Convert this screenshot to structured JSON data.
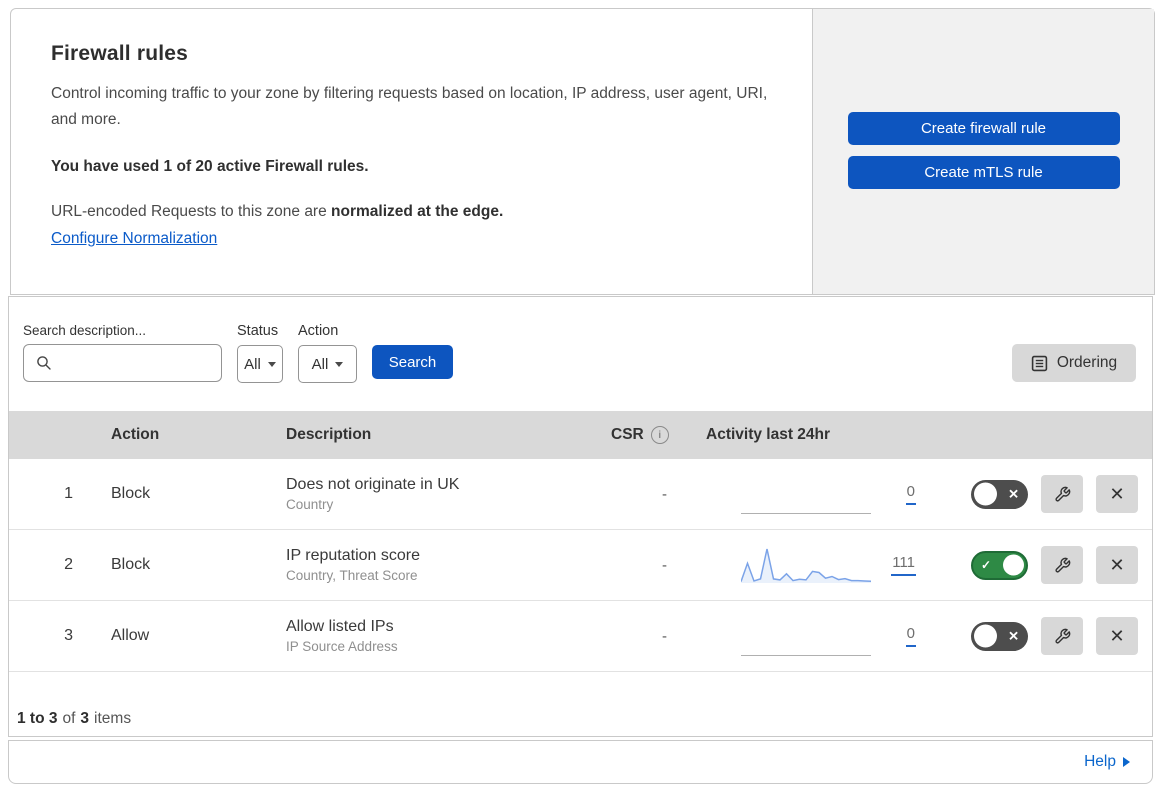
{
  "hero": {
    "title": "Firewall rules",
    "description": "Control incoming traffic to your zone by filtering requests based on location, IP address, user agent, URI, and more.",
    "usage_bold": "You have used 1 of 20 active Firewall rules.",
    "normalization_text": "URL-encoded Requests to this zone are ",
    "normalization_bold": "normalized at the edge.",
    "normalization_link": "Configure Normalization",
    "buttons": {
      "create_firewall": "Create firewall rule",
      "create_mtls": "Create mTLS rule"
    }
  },
  "filters": {
    "search_label": "Search description...",
    "search_value": "",
    "status_label": "Status",
    "status_value": "All",
    "action_label": "Action",
    "action_value": "All",
    "search_button": "Search",
    "ordering_button": "Ordering"
  },
  "table": {
    "headers": {
      "action": "Action",
      "description": "Description",
      "csr": "CSR",
      "activity": "Activity last 24hr"
    },
    "rows": [
      {
        "priority": "1",
        "action": "Block",
        "description": "Does not originate in UK",
        "fields": "Country",
        "csr": "-",
        "activity_count": "0",
        "enabled": false,
        "sparkline": null
      },
      {
        "priority": "2",
        "action": "Block",
        "description": "IP reputation score",
        "fields": "Country, Threat Score",
        "csr": "-",
        "activity_count": "111",
        "enabled": true,
        "sparkline": [
          4,
          58,
          6,
          12,
          100,
          12,
          9,
          27,
          7,
          11,
          9,
          34,
          31,
          14,
          19,
          10,
          13,
          7,
          7,
          6,
          5
        ]
      },
      {
        "priority": "3",
        "action": "Allow",
        "description": "Allow listed IPs",
        "fields": "IP Source Address",
        "csr": "-",
        "activity_count": "0",
        "enabled": false,
        "sparkline": null
      }
    ],
    "footer": {
      "range": "1 to 3",
      "of": "of",
      "total": "3",
      "items": "items"
    }
  },
  "help": {
    "label": "Help"
  },
  "icons": {
    "search": "magnifier",
    "ordering": "document-lines",
    "wrench": "wrench",
    "close_glyph": "✕",
    "toggle_on_glyph": "✓",
    "toggle_off_glyph": "✕",
    "info_glyph": "i"
  },
  "colors": {
    "primary_blue": "#0d55bf",
    "link_blue": "#0b5bc9",
    "toggle_on_green": "#2e8a45",
    "toggle_off_gray": "#4d4d4d",
    "sparkline_line": "#7ba3e8",
    "sparkline_fill": "#eaf1fb",
    "count_underline": "#2166c9",
    "table_header_bg": "#d9d9d9",
    "panel_gray": "#f1f1f1",
    "button_gray": "#d8d8d8"
  }
}
